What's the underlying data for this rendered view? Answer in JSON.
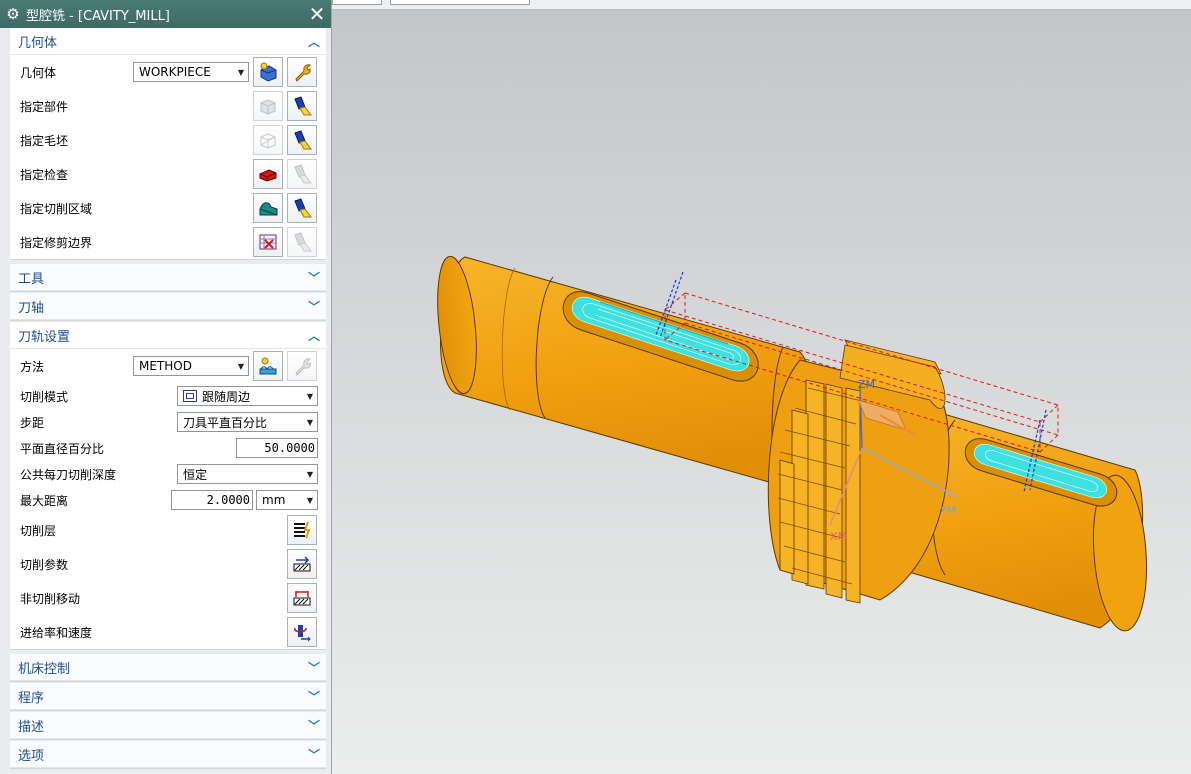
{
  "dialog": {
    "title": "型腔铣 - [CAVITY_MILL]",
    "close_glyph": "✕"
  },
  "geometry_group": {
    "header": "几何体",
    "geometry_label": "几何体",
    "geometry_value": "WORKPIECE",
    "rows": {
      "part": "指定部件",
      "blank": "指定毛坯",
      "check": "指定检查",
      "cut_area": "指定切削区域",
      "trim": "指定修剪边界"
    }
  },
  "tool_group": {
    "header": "工具"
  },
  "axis_group": {
    "header": "刀轴"
  },
  "path_group": {
    "header": "刀轨设置",
    "method_label": "方法",
    "method_value": "METHOD",
    "cut_pattern_label": "切削模式",
    "cut_pattern_value": "跟随周边",
    "stepover_label": "步距",
    "stepover_value": "刀具平直百分比",
    "flat_pct_label": "平面直径百分比",
    "flat_pct_value": "50.0000",
    "depth_label": "公共每刀切削深度",
    "depth_value": "恒定",
    "max_dist_label": "最大距离",
    "max_dist_value": "2.0000",
    "max_dist_unit": "mm",
    "cut_levels": "切削层",
    "cut_params": "切削参数",
    "non_cut": "非切削移动",
    "feeds": "进给率和速度"
  },
  "machine_group": {
    "header": "机床控制"
  },
  "program_group": {
    "header": "程序"
  },
  "desc_group": {
    "header": "描述"
  },
  "options_group": {
    "header": "选项"
  },
  "viewport": {
    "axis_labels": {
      "zm": "ZM",
      "ym": "YM",
      "xm": "XM"
    }
  },
  "colors": {
    "part": "#f2a815",
    "part_dark": "#c07f0a",
    "toolpath": "#35d3d3",
    "title_bar": "#3f6d67",
    "header_text": "#1f4f99"
  }
}
